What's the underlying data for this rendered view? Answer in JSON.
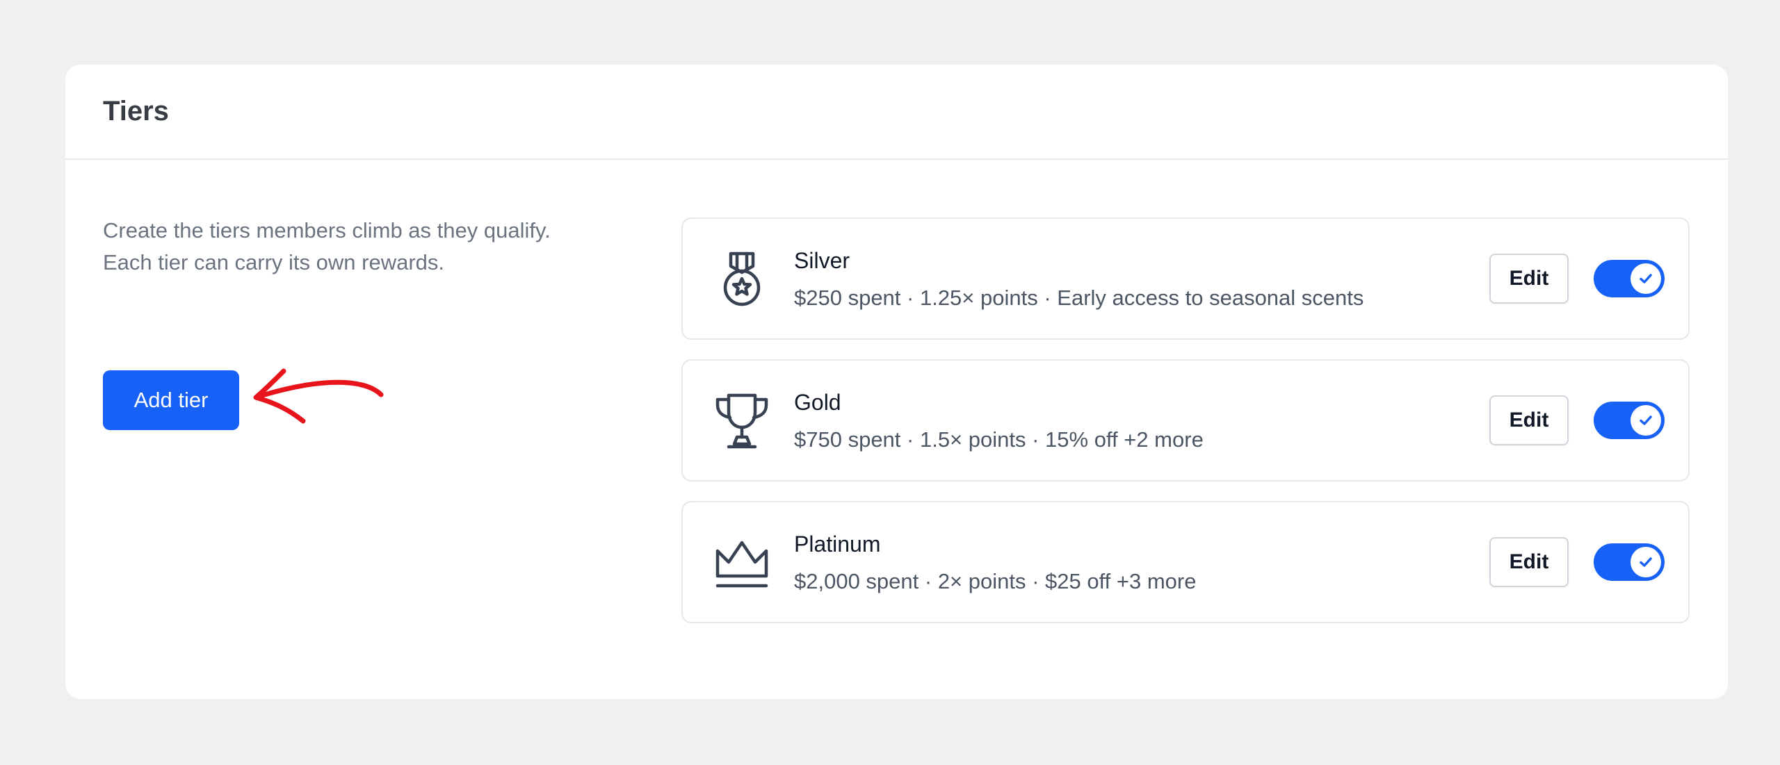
{
  "card": {
    "title": "Tiers"
  },
  "intro": {
    "line1": "Create the tiers members climb as they qualify.",
    "line2": "Each tier can carry its own rewards.",
    "add_button": "Add tier"
  },
  "tiers": [
    {
      "name": "Silver",
      "details": "$250 spent · 1.25× points · Early access to seasonal scents",
      "icon": "medal-icon",
      "edit_label": "Edit",
      "enabled": true
    },
    {
      "name": "Gold",
      "details": "$750 spent · 1.5× points · 15% off +2 more",
      "icon": "trophy-icon",
      "edit_label": "Edit",
      "enabled": true
    },
    {
      "name": "Platinum",
      "details": "$2,000 spent · 2× points · $25 off +3 more",
      "icon": "crown-icon",
      "edit_label": "Edit",
      "enabled": true
    }
  ],
  "colors": {
    "accent": "#1861f6",
    "annotation": "#e8141c",
    "background": "#f0f0f0"
  }
}
